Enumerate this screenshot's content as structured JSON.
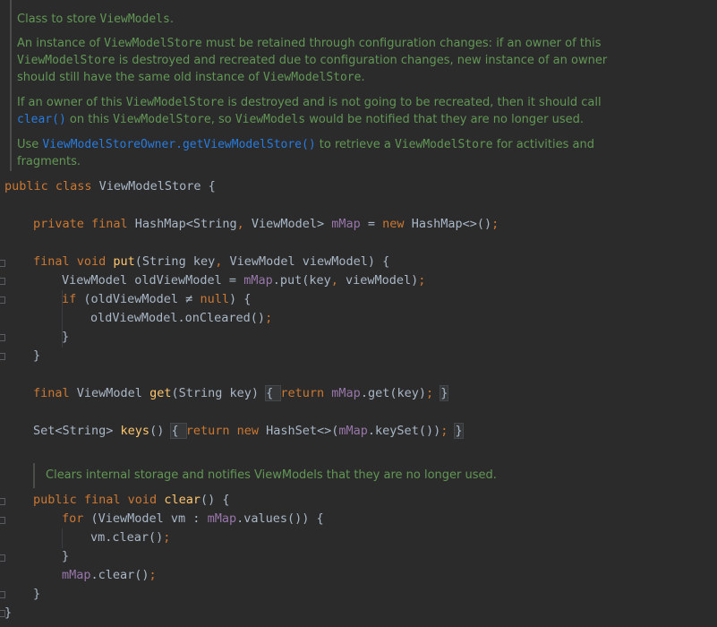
{
  "doc": {
    "p1": {
      "t1": "Class to store ",
      "c1": "ViewModels",
      "t2": "."
    },
    "p2": {
      "t1": "An instance of ",
      "c1": "ViewModelStore",
      "t2": " must be retained through configuration changes: if an owner of this",
      "c2": "ViewModelStore",
      "t3": " is destroyed and recreated due to configuration changes, new instance of an owner",
      "t4": "should still have the same old instance of ",
      "c3": "ViewModelStore",
      "t5": "."
    },
    "p3": {
      "t1": "If an owner of this ",
      "c1": "ViewModelStore",
      "t2": " is destroyed and is not going to be recreated, then it should call",
      "c2": "clear()",
      "t3": " on this ",
      "c3": "ViewModelStore",
      "t4": ", so ",
      "c4": "ViewModels",
      "t5": " would be notified that they are no longer used."
    },
    "p4": {
      "t1": "Use ",
      "c1": "ViewModelStoreOwner.getViewModelStore()",
      "t2": " to retrieve a ",
      "c2": "ViewModelStore",
      "t3": " for activities and",
      "t4": "fragments."
    }
  },
  "doc2": "Clears internal storage and notifies ViewModels that they are no longer used.",
  "code": {
    "l1": {
      "kw": "public class ",
      "rest": "ViewModelStore {"
    },
    "l2": {
      "kw1": "private final ",
      "t1": "HashMap<String",
      "p1": ", ",
      "t2": "ViewModel> ",
      "f1": "mMap",
      "t3": " = ",
      "kw2": "new ",
      "t4": "HashMap<>()",
      "p2": ";"
    },
    "l3": {
      "kw1": "final void ",
      "fn": "put",
      "t1": "(String key",
      "p1": ", ",
      "t2": "ViewModel viewModel) {"
    },
    "l4": {
      "t1": "ViewModel oldViewModel = ",
      "f1": "mMap",
      "t2": ".put(key",
      "p1": ", ",
      "t3": "viewModel)",
      "p2": ";"
    },
    "l5": {
      "kw1": "if ",
      "t1": "(oldViewModel ≠ ",
      "kw2": "null",
      "t2": ") {"
    },
    "l6": {
      "t1": "oldViewModel.onCleared()",
      "p1": ";"
    },
    "l7": "}",
    "l8": "}",
    "l9": {
      "kw1": "final ",
      "t1": "ViewModel ",
      "fn": "get",
      "t2": "(String key) ",
      "b1": "{ ",
      "kw2": "return ",
      "f1": "mMap",
      "t3": ".get(key)",
      "p1": "; ",
      "b2": "}"
    },
    "l10": {
      "t1": "Set<String> ",
      "fn": "keys",
      "t2": "() ",
      "b1": "{ ",
      "kw1": "return new ",
      "t3": "HashSet<>(",
      "f1": "mMap",
      "t4": ".keySet())",
      "p1": "; ",
      "b2": "}"
    },
    "l11": {
      "kw1": "public final void ",
      "fn": "clear",
      "t1": "() {"
    },
    "l12": {
      "kw1": "for ",
      "t1": "(ViewModel vm : ",
      "f1": "mMap",
      "t2": ".values()) {"
    },
    "l13": {
      "t1": "vm.clear()",
      "p1": ";"
    },
    "l14": "}",
    "l15": {
      "f1": "mMap",
      "t1": ".clear()",
      "p1": ";"
    },
    "l16": "}",
    "l17": "}"
  }
}
